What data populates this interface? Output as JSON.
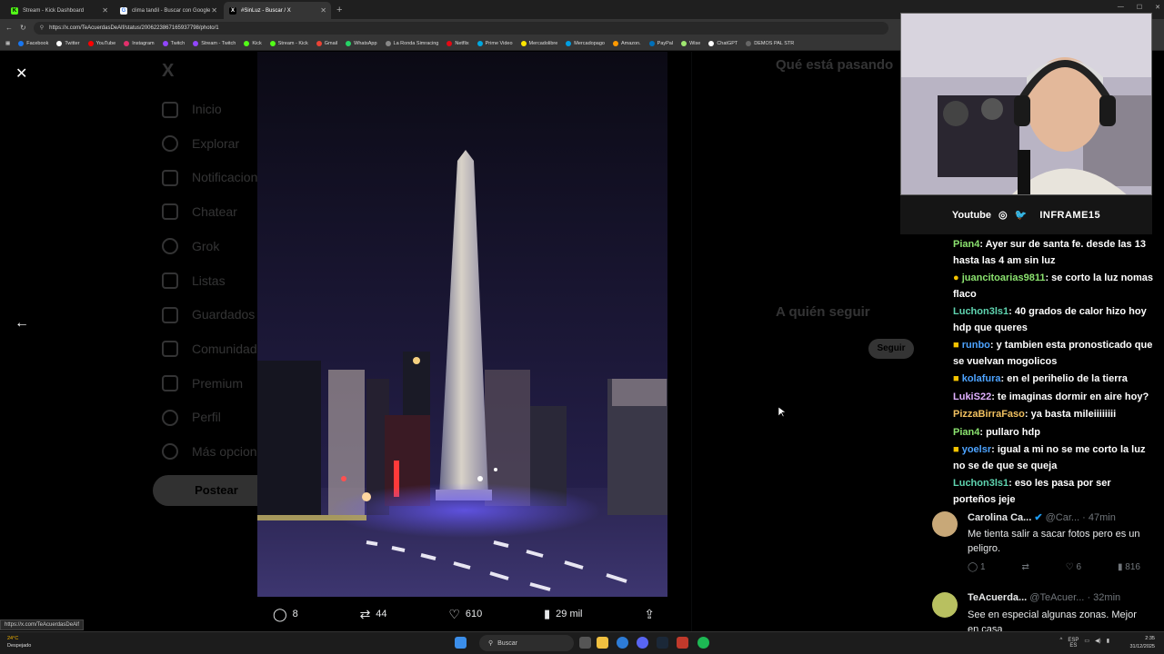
{
  "browser": {
    "tabs": [
      {
        "label": "Stream - Kick Dashboard",
        "icon_color": "#53fc18",
        "active": false
      },
      {
        "label": "clima tandil - Buscar con Google",
        "icon_color": "#4285f4",
        "active": false
      },
      {
        "label": "#SinLuz - Buscar / X",
        "icon_color": "#000000",
        "active": true
      }
    ],
    "url": "https://x.com/TeAcuerdasDeAlf/status/2006223867165937798/photo/1",
    "bookmarks": [
      "Facebook",
      "Twitter",
      "YouTube",
      "Instagram",
      "Twitch",
      "Stream - Twitch",
      "Kick",
      "Stream - Kick",
      "Gmail",
      "WhatsApp",
      "La Ronda Simracing",
      "Netflix",
      "Prime Video",
      "Mercadolibre",
      "Mercadopago",
      "Amazon.",
      "PayPal",
      "Wise",
      "ChatGPT",
      "DEMOS PAL STR"
    ]
  },
  "x_nav": [
    "Inicio",
    "Explorar",
    "Notificaciones",
    "Chatear",
    "Grok",
    "Listas",
    "Guardados",
    "Comunidades",
    "Premium",
    "Perfil",
    "Más opciones"
  ],
  "x_post_button": "Postear",
  "x_right": {
    "title": "Qué está pasando",
    "who_to_follow": "A quién seguir",
    "follow_label": "Seguir"
  },
  "photo_viewer": {
    "replies": "8",
    "reposts": "44",
    "likes": "610",
    "views": "29 mil"
  },
  "stream_social": {
    "youtube": "Youtube",
    "handle": "INFRAME15"
  },
  "chat": [
    {
      "user": "Pian4",
      "color": "#8be36f",
      "text": ": Ayer sur de santa fe. desde las 13 hasta las 4 am sin luz"
    },
    {
      "user": "juancitoarias9811",
      "color": "#8be36f",
      "text": ": se corto la luz nomas flaco"
    },
    {
      "user": "Luchon3ls1",
      "color": "#5fd4b0",
      "text": ": 40 grados de calor hizo hoy hdp que queres"
    },
    {
      "user": "runbo",
      "color": "#4da3ff",
      "text": ": y tambien esta pronosticado que se vuelvan mogolicos"
    },
    {
      "user": "kolafura",
      "color": "#4da3ff",
      "text": ": en el perihelio de la tierra"
    },
    {
      "user": "LukiS22",
      "color": "#e0b0ff",
      "text": ": te imaginas dormir en aire hoy?"
    },
    {
      "user": "PizzaBirraFaso",
      "color": "#f0c060",
      "text": ": ya basta mileiiiiiiii"
    },
    {
      "user": "Pian4",
      "color": "#8be36f",
      "text": ": pullaro hdp"
    },
    {
      "user": "yoelsr",
      "color": "#4da3ff",
      "text": ": igual a mi no se me corto la luz no se de que se queja"
    },
    {
      "user": "Luchon3ls1",
      "color": "#5fd4b0",
      "text": ": eso les pasa por ser porteños jeje"
    }
  ],
  "replies_panel": [
    {
      "name": "Carolina Ca...",
      "handle": "@Car...",
      "time": "47min",
      "text": "Me tienta salir a sacar fotos pero es un peligro.",
      "comments": "1",
      "likes": "6",
      "views": "816"
    },
    {
      "name": "TeAcuerda...",
      "handle": "@TeAcuer...",
      "time": "32min",
      "text": "See en especial algunas zonas. Mejor en casa",
      "comments": "",
      "likes": "",
      "views": ""
    }
  ],
  "status_bar_url": "https://x.com/TeAcuerdasDeAlf",
  "taskbar": {
    "weather_temp": "24°C",
    "weather_desc": "Despejado",
    "search": "Buscar",
    "lang": "ESP",
    "lang2": "ES",
    "time": "2:35",
    "date": "31/12/2025"
  }
}
